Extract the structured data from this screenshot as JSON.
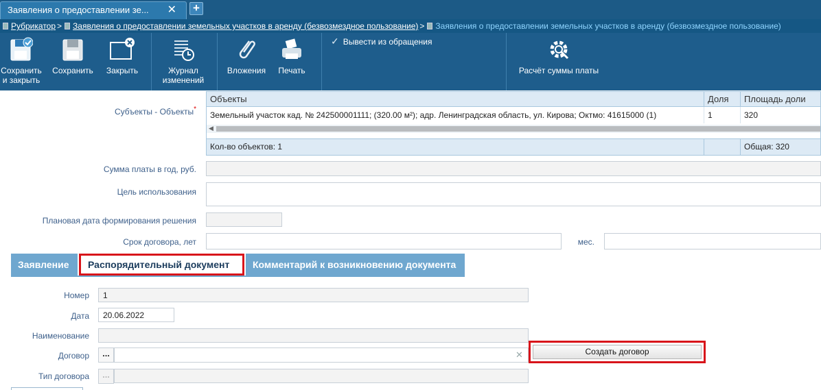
{
  "tab": {
    "title": "Заявления о предоставлении зе...",
    "close": "✕",
    "new": "+"
  },
  "breadcrumb": {
    "root": "Рубрикатор",
    "level1": "Заявления о предоставлении земельных участков в аренду (безвозмездное пользование)",
    "current": "Заявления о предоставлении земельных участков в аренду (безвозмездное пользование)",
    "sep": ">"
  },
  "toolbar": {
    "save_close_line1": "Сохранить",
    "save_close_line2": "и закрыть",
    "save": "Сохранить",
    "close": "Закрыть",
    "journal_line1": "Журнал",
    "journal_line2": "изменений",
    "attachments": "Вложения",
    "print": "Печать",
    "withdraw": "Вывести из обращения",
    "calc": "Расчёт суммы платы"
  },
  "form": {
    "subjects_label": "Субъекты - Объекты",
    "required_mark": "*",
    "payment_label": "Сумма платы в год, руб.",
    "payment_value": "",
    "purpose_label": "Цель использования",
    "purpose_value": "",
    "plan_date_label": "Плановая дата формирования решения",
    "plan_date_value": "",
    "term_label": "Срок договора, лет",
    "term_years": "",
    "months_label": "мес.",
    "term_months": ""
  },
  "grid": {
    "headers": [
      "Объекты",
      "Доля",
      "Площадь доли"
    ],
    "row": {
      "object": "Земельный участок кад. № 242500001111; (320.00 м²); адр. Ленинградская область, ул. Кирова; Октмо: 41615000 (1)",
      "share": "1",
      "area": "320"
    },
    "footer_count": "Кол-во объектов: 1",
    "footer_total": "Общая: 320"
  },
  "tabs": [
    "Заявление",
    "Распорядительный документ",
    "Комментарий к возникновению документа"
  ],
  "doc": {
    "number_label": "Номер",
    "number_value": "1",
    "date_label": "Дата",
    "date_value": "20.06.2022",
    "name_label": "Наименование",
    "name_value": "",
    "contract_label": "Договор",
    "contract_value": "",
    "contract_type_label": "Тип договора",
    "contract_type_value": "",
    "pick": "...",
    "clear": "✕",
    "create_button": "Создать договор"
  },
  "colors": {
    "toolbar": "#1e5d8c",
    "tab_active_border": "#d8141a",
    "label": "#3d5f8a"
  }
}
